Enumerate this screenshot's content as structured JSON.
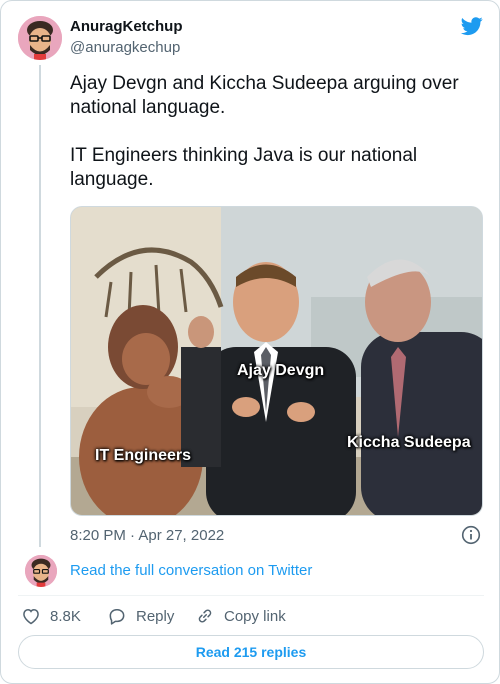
{
  "author": {
    "display_name": "AnuragKetchup",
    "handle": "@anuragkechup"
  },
  "tweet": {
    "text": "Ajay Devgn and Kiccha Sudeepa arguing over national language.\n\nIT Engineers thinking Java is our national language.",
    "timestamp": "8:20 PM · Apr 27, 2022"
  },
  "media": {
    "labels": {
      "center": "Ajay Devgn",
      "left": "IT Engineers",
      "right": "Kiccha Sudeepa"
    }
  },
  "conversation_link": "Read the full conversation on Twitter",
  "actions": {
    "likes": "8.8K",
    "reply": "Reply",
    "copy_link": "Copy link"
  },
  "read_replies": "Read 215 replies",
  "colors": {
    "accent": "#1d9bf0",
    "secondary_text": "#536471",
    "border": "#cfd9de"
  },
  "icons": [
    "twitter-bird-icon",
    "info-icon",
    "heart-icon",
    "reply-icon",
    "link-icon"
  ]
}
